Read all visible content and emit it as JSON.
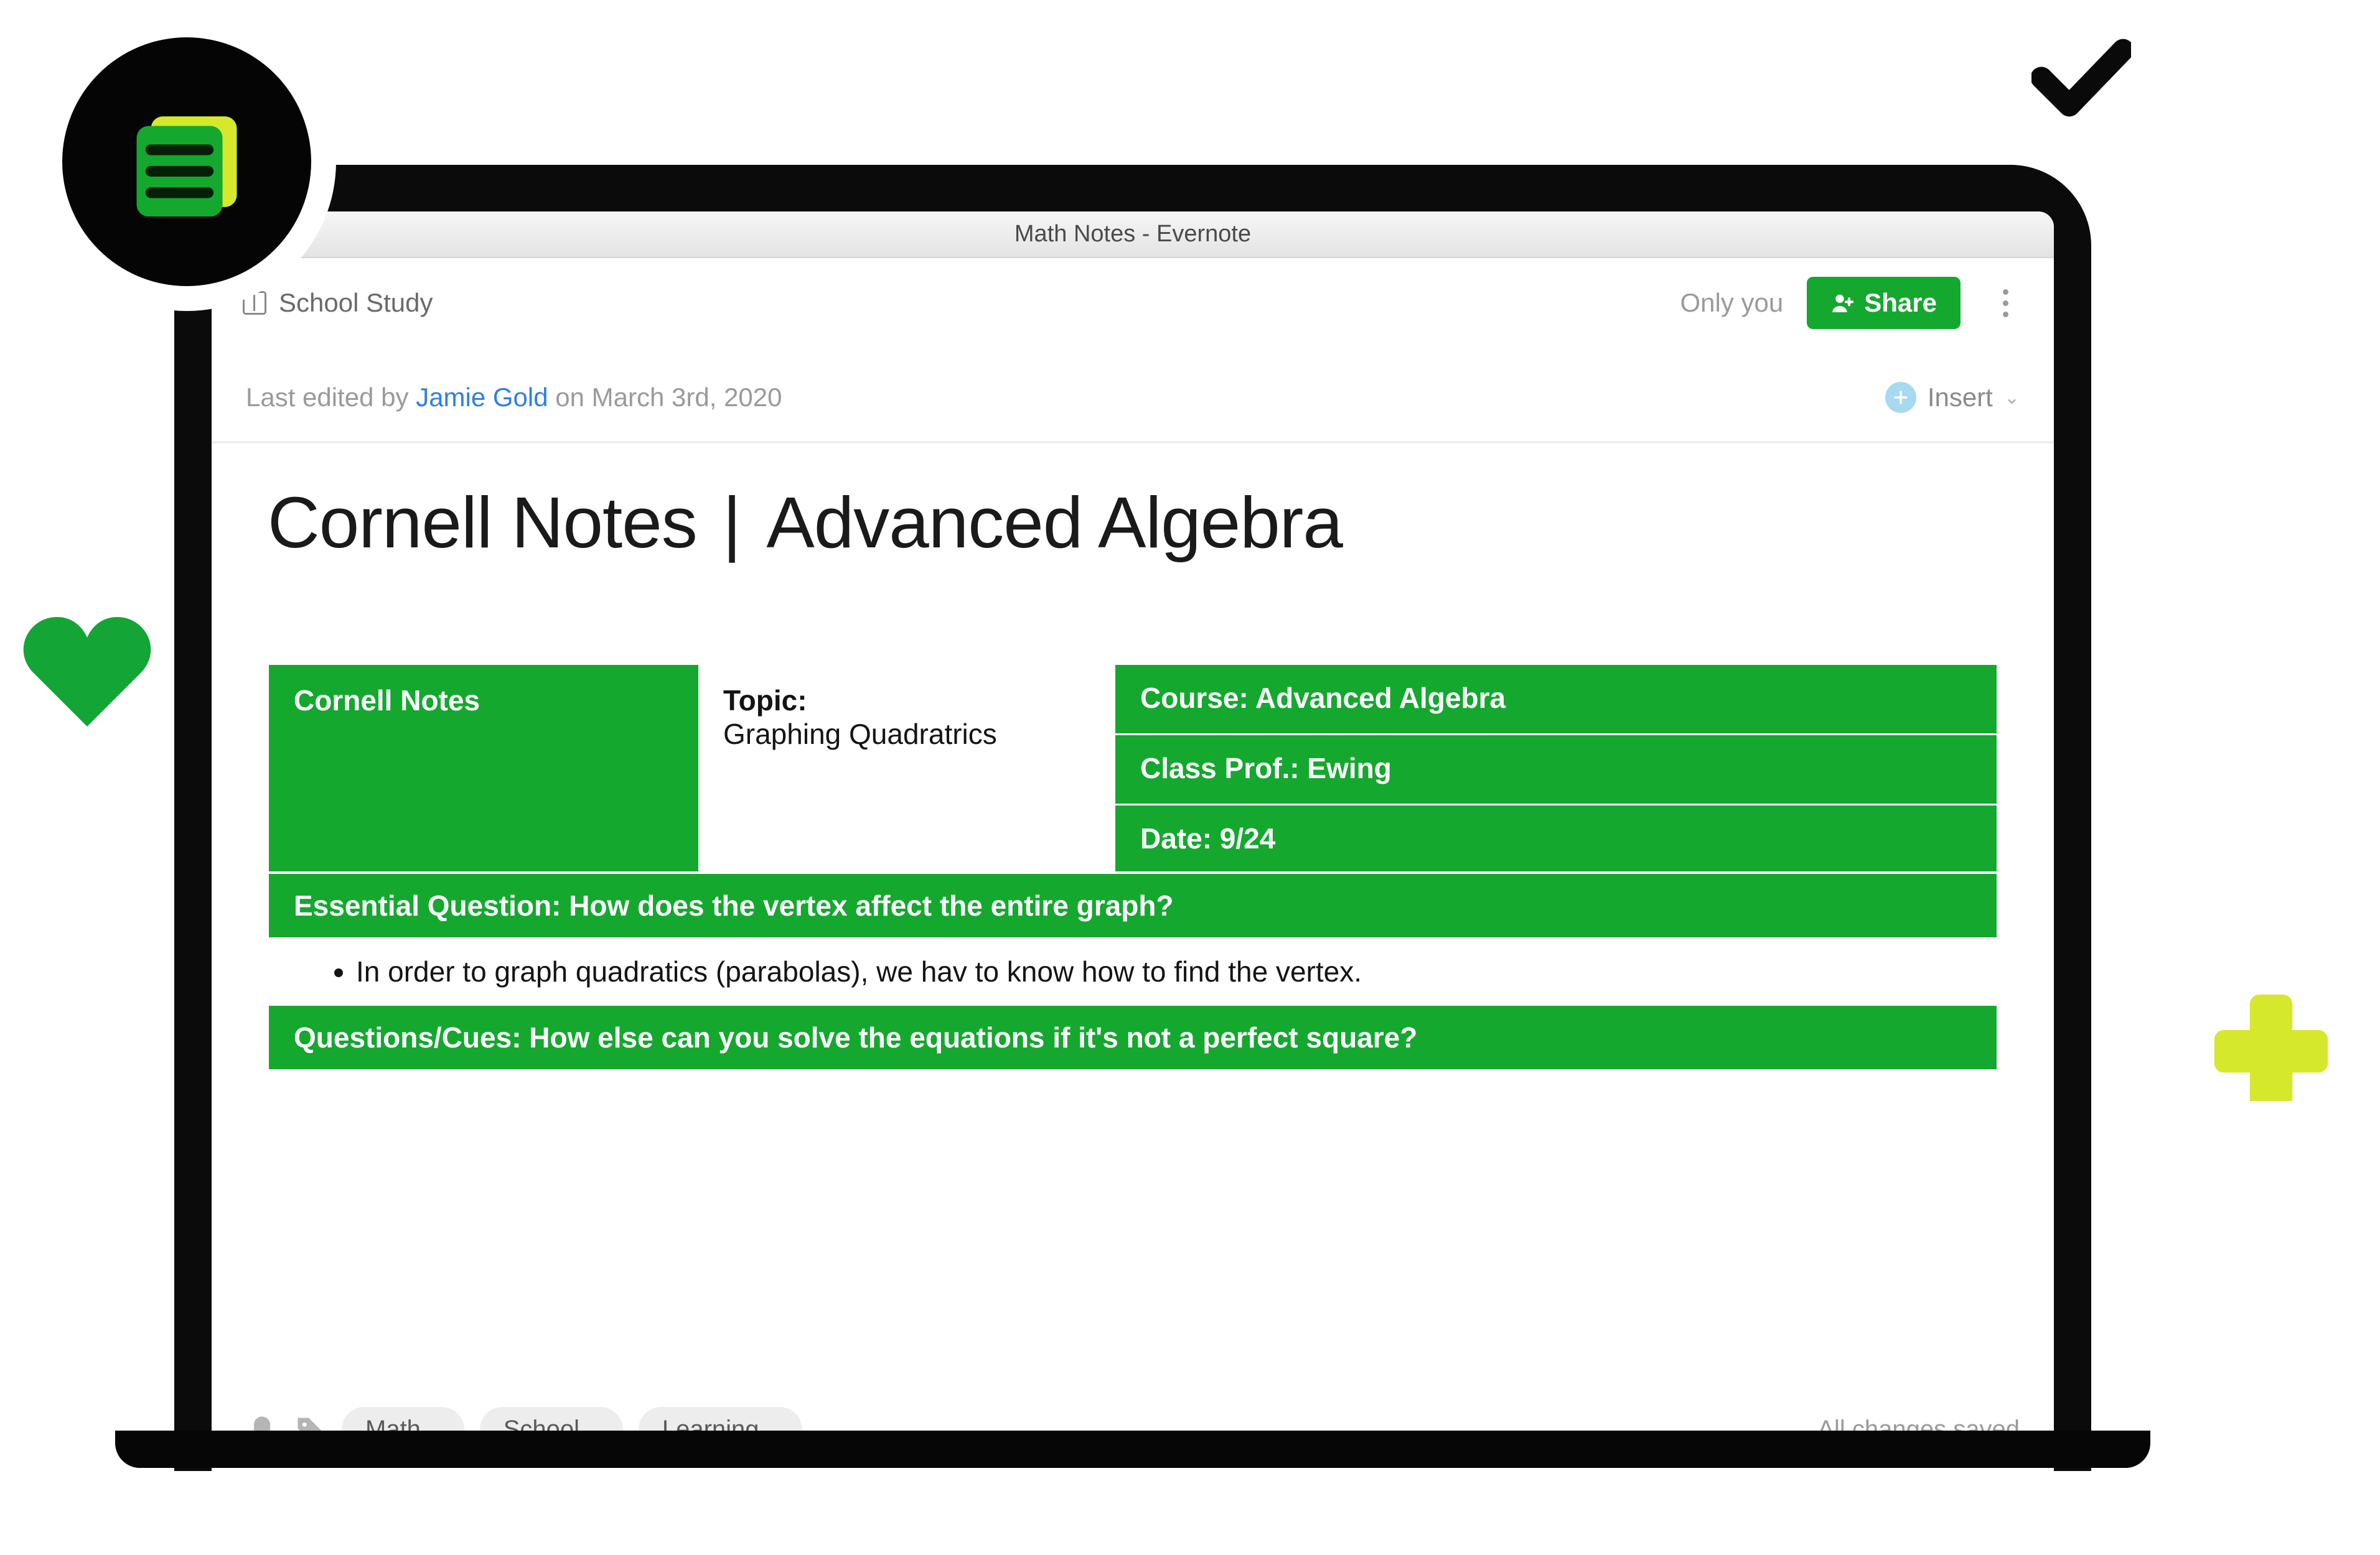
{
  "window": {
    "title": "Math Notes - Evernote"
  },
  "header": {
    "notebook": "School Study",
    "access": "Only you",
    "share": "Share"
  },
  "meta": {
    "prefix": "Last edited by ",
    "editor": "Jamie Gold",
    "suffix": " on March 3rd, 2020",
    "insert": "Insert"
  },
  "note": {
    "title_left": "Cornell Notes",
    "title_right": "Advanced Algebra"
  },
  "cornell": {
    "heading": "Cornell Notes",
    "topic_label": "Topic:",
    "topic_value": "Graphing Quadratrics",
    "course": "Course: Advanced Algebra",
    "prof": "Class Prof.: Ewing",
    "date": "Date: 9/24",
    "essential": "Essential Question: How does the vertex affect the entire graph?",
    "bullet1": "In order to graph quadratics (parabolas), we hav to know how to find the vertex.",
    "questions": "Questions/Cues: How else can you solve the equations if it's not a perfect square?"
  },
  "footer": {
    "tags": [
      "Math",
      "School",
      "Learning"
    ],
    "status": "All changes saved"
  }
}
